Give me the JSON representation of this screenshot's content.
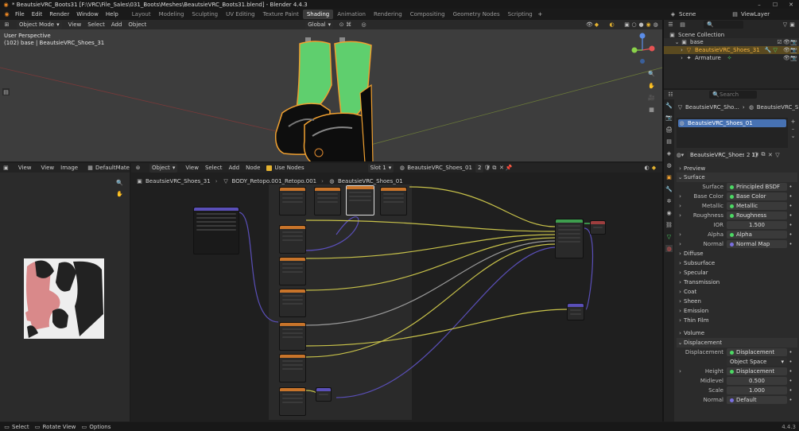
{
  "app": {
    "title": "* BeautsieVRC_Boots31 [F:\\VRC\\File_Sales\\031_Boots\\Meshes\\BeautsieVRC_Boots31.blend] - Blender 4.4.3",
    "menus": [
      "File",
      "Edit",
      "Render",
      "Window",
      "Help"
    ],
    "workspaces": [
      "Layout",
      "Modeling",
      "Sculpting",
      "UV Editing",
      "Texture Paint",
      "Shading",
      "Animation",
      "Rendering",
      "Compositing",
      "Geometry Nodes",
      "Scripting"
    ],
    "active_workspace": "Shading",
    "scene": "Scene",
    "view_layer": "ViewLayer"
  },
  "viewport": {
    "mode": "Object Mode",
    "menus": [
      "View",
      "Select",
      "Add",
      "Object"
    ],
    "orientation": "Global",
    "overlay_line1": "User Perspective",
    "overlay_line2": "(102) base | BeautsieVRC_Shoes_31",
    "axes": [
      "Y",
      "X",
      "Z"
    ]
  },
  "outliner": {
    "search_placeholder": "",
    "items": [
      {
        "label": "Scene Collection",
        "level": 0,
        "type": "collection"
      },
      {
        "label": "base",
        "level": 1,
        "type": "collection"
      },
      {
        "label": "BeautsieVRC_Shoes_31",
        "level": 2,
        "type": "mesh",
        "selected": true
      },
      {
        "label": "Armature",
        "level": 2,
        "type": "armature"
      }
    ]
  },
  "image_editor": {
    "menus": [
      "View",
      "View",
      "Image"
    ],
    "image_name": "DefaultMate"
  },
  "node_editor": {
    "object_mode": "Object",
    "menus": [
      "View",
      "Select",
      "Add",
      "Node"
    ],
    "use_nodes_label": "Use Nodes",
    "slot": "Slot 1",
    "material": "BeautsieVRC_Shoes_01",
    "users": "2",
    "breadcrumbs": [
      "BeautsieVRC_Shoes_31",
      "BODY_Retopo.001_Retopo.001",
      "BeautsieVRC_Shoes_01"
    ]
  },
  "properties": {
    "search_placeholder": "Search",
    "breadcrumb": [
      "BeautsieVRC_Sho...",
      "BeautsieVRC_Sho..."
    ],
    "material_slot": "BeautsieVRC_Shoes_01",
    "material_name": "BeautsieVRC_Shoes_01",
    "material_users": "2",
    "sections": {
      "preview": "Preview",
      "surface": "Surface",
      "diffuse": "Diffuse",
      "subsurface": "Subsurface",
      "specular": "Specular",
      "transmission": "Transmission",
      "coat": "Coat",
      "sheen": "Sheen",
      "emission": "Emission",
      "thin_film": "Thin Film",
      "volume": "Volume",
      "displacement": "Displacement"
    },
    "surface_rows": [
      {
        "label": "Surface",
        "value": "Principled BSDF",
        "color": "#4cd964"
      },
      {
        "label": "Base Color",
        "value": "Base Color",
        "color": "#4cd964",
        "expand": true
      },
      {
        "label": "Metallic",
        "value": "Metallic",
        "color": "#4cd964",
        "expand": true
      },
      {
        "label": "Roughness",
        "value": "Roughness",
        "color": "#4cd964",
        "expand": true
      },
      {
        "label": "IOR",
        "value": "1.500",
        "numeric": true
      },
      {
        "label": "Alpha",
        "value": "Alpha",
        "color": "#4cd964",
        "expand": true
      },
      {
        "label": "Normal",
        "value": "Normal Map",
        "color": "#7a6fe0",
        "expand": true
      }
    ],
    "displacement_rows": [
      {
        "label": "Displacement",
        "value": "Displacement",
        "color": "#4cd964"
      },
      {
        "label": "",
        "value": "Object Space",
        "dropdown": true
      },
      {
        "label": "Height",
        "value": "Displacement",
        "color": "#4cd964",
        "expand": true
      },
      {
        "label": "Midlevel",
        "value": "0.500",
        "numeric": true
      },
      {
        "label": "Scale",
        "value": "1.000",
        "numeric": true
      },
      {
        "label": "Normal",
        "value": "Default",
        "color": "#7a6fe0"
      }
    ]
  },
  "status_bar": {
    "items": [
      "Select",
      "Rotate View",
      "Options"
    ],
    "version": "4.4.3"
  }
}
